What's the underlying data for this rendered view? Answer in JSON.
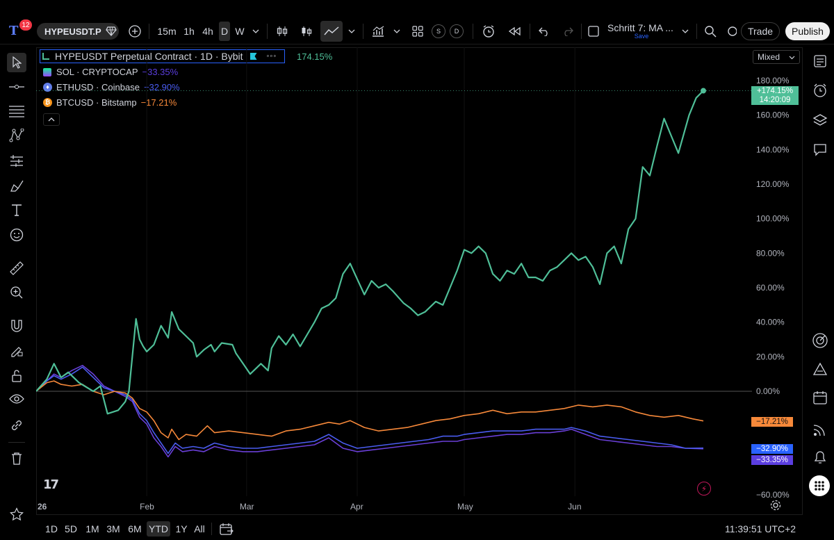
{
  "topbar": {
    "notification_count": "12",
    "symbol": "HYPEUSDT.P",
    "intervals": [
      "15m",
      "1h",
      "4h",
      "D",
      "W"
    ],
    "active_interval": "D",
    "indicator_s": "S",
    "indicator_d": "D",
    "layout_name": "Schritt 7: MA ...",
    "save_label": "Save",
    "trade_label": "Trade",
    "publish_label": "Publish"
  },
  "legend": {
    "main_title": "HYPEUSDT Perpetual Contract · 1D · Bybit",
    "main_change": "174.15%",
    "items": [
      {
        "name": "SOL · CRYPTOCAP",
        "change": "−33.35%",
        "color": "#5b3ee0"
      },
      {
        "name": "ETHUSD · Coinbase",
        "change": "−32.90%",
        "color": "#4a5cf0"
      },
      {
        "name": "BTCUSD · Bitstamp",
        "change": "−17.21%",
        "color": "#f7893a"
      }
    ]
  },
  "scale_mode": "Mixed",
  "price_labels": {
    "hype_value": "+174.15%",
    "hype_countdown": "14:20:09",
    "btc": "−17.21%",
    "eth": "−32.90%",
    "sol": "−33.35%"
  },
  "colors": {
    "hype": "#4fbf98",
    "btc": "#f7893a",
    "eth": "#4a5cf0",
    "sol": "#6a3fd8"
  },
  "chart_data": {
    "type": "line",
    "ylabel": "% change",
    "ylim": [
      -60,
      180
    ],
    "yticks": [
      180,
      160,
      140,
      120,
      100,
      80,
      60,
      40,
      20,
      0,
      -20,
      -40,
      -60
    ],
    "ytick_labels": [
      "180.00%",
      "160.00%",
      "140.00%",
      "120.00%",
      "100.00%",
      "80.00%",
      "60.00%",
      "40.00%",
      "20.00%",
      "0.00%",
      "",
      "",
      "−60.00%"
    ],
    "xticks": [
      {
        "label": "26",
        "day": 0
      },
      {
        "label": "Feb",
        "day": 31
      },
      {
        "label": "Mar",
        "day": 59
      },
      {
        "label": "Apr",
        "day": 90
      },
      {
        "label": "May",
        "day": 120
      },
      {
        "label": "Jun",
        "day": 151
      }
    ],
    "series": [
      {
        "name": "HYPEUSDT Perpetual Contract",
        "points": [
          [
            0,
            0
          ],
          [
            3,
            7
          ],
          [
            5,
            16
          ],
          [
            7,
            8
          ],
          [
            9,
            11
          ],
          [
            12,
            5
          ],
          [
            16,
            0
          ],
          [
            18,
            3
          ],
          [
            20,
            -13
          ],
          [
            23,
            -11
          ],
          [
            25,
            -6
          ],
          [
            26,
            0
          ],
          [
            27,
            21
          ],
          [
            28,
            42
          ],
          [
            29,
            30
          ],
          [
            30,
            26
          ],
          [
            31,
            23
          ],
          [
            33,
            27
          ],
          [
            35,
            38
          ],
          [
            37,
            31
          ],
          [
            38,
            46
          ],
          [
            40,
            36
          ],
          [
            42,
            32
          ],
          [
            44,
            28
          ],
          [
            45,
            20
          ],
          [
            47,
            24
          ],
          [
            49,
            27
          ],
          [
            50,
            23
          ],
          [
            52,
            28
          ],
          [
            55,
            27
          ],
          [
            56,
            22
          ],
          [
            58,
            16
          ],
          [
            60,
            10
          ],
          [
            63,
            16
          ],
          [
            65,
            12
          ],
          [
            66,
            25
          ],
          [
            68,
            32
          ],
          [
            70,
            27
          ],
          [
            72,
            33
          ],
          [
            74,
            26
          ],
          [
            76,
            33
          ],
          [
            78,
            40
          ],
          [
            80,
            48
          ],
          [
            82,
            50
          ],
          [
            84,
            54
          ],
          [
            86,
            68
          ],
          [
            88,
            74
          ],
          [
            90,
            65
          ],
          [
            92,
            56
          ],
          [
            94,
            64
          ],
          [
            96,
            60
          ],
          [
            98,
            62
          ],
          [
            100,
            58
          ],
          [
            103,
            51
          ],
          [
            105,
            48
          ],
          [
            107,
            44
          ],
          [
            109,
            46
          ],
          [
            112,
            52
          ],
          [
            114,
            50
          ],
          [
            116,
            60
          ],
          [
            118,
            70
          ],
          [
            120,
            82
          ],
          [
            122,
            80
          ],
          [
            124,
            84
          ],
          [
            126,
            80
          ],
          [
            128,
            68
          ],
          [
            130,
            64
          ],
          [
            132,
            70
          ],
          [
            134,
            68
          ],
          [
            136,
            74
          ],
          [
            138,
            66
          ],
          [
            140,
            66
          ],
          [
            142,
            64
          ],
          [
            144,
            70
          ],
          [
            146,
            72
          ],
          [
            148,
            76
          ],
          [
            150,
            80
          ],
          [
            152,
            76
          ],
          [
            154,
            78
          ],
          [
            156,
            72
          ],
          [
            158,
            62
          ],
          [
            160,
            80
          ],
          [
            162,
            84
          ],
          [
            164,
            74
          ],
          [
            166,
            94
          ],
          [
            168,
            100
          ],
          [
            170,
            130
          ],
          [
            172,
            125
          ],
          [
            174,
            142
          ],
          [
            176,
            158
          ],
          [
            178,
            148
          ],
          [
            180,
            138
          ],
          [
            183,
            160
          ],
          [
            185,
            170
          ],
          [
            187,
            174.15
          ]
        ]
      },
      {
        "name": "BTCUSD · Bitstamp",
        "points": [
          [
            0,
            0
          ],
          [
            3,
            5
          ],
          [
            5,
            6
          ],
          [
            7,
            4
          ],
          [
            10,
            3
          ],
          [
            13,
            4
          ],
          [
            16,
            0
          ],
          [
            19,
            -2
          ],
          [
            22,
            0
          ],
          [
            25,
            -1
          ],
          [
            27,
            -4
          ],
          [
            29,
            -10
          ],
          [
            31,
            -12
          ],
          [
            33,
            -17
          ],
          [
            35,
            -24
          ],
          [
            37,
            -27
          ],
          [
            38,
            -22
          ],
          [
            40,
            -28
          ],
          [
            42,
            -25
          ],
          [
            45,
            -26
          ],
          [
            48,
            -20
          ],
          [
            50,
            -24
          ],
          [
            54,
            -23
          ],
          [
            58,
            -24
          ],
          [
            62,
            -25
          ],
          [
            66,
            -26
          ],
          [
            70,
            -23
          ],
          [
            74,
            -22
          ],
          [
            78,
            -20
          ],
          [
            82,
            -18
          ],
          [
            85,
            -19
          ],
          [
            88,
            -17
          ],
          [
            92,
            -21
          ],
          [
            96,
            -23
          ],
          [
            100,
            -22
          ],
          [
            104,
            -21
          ],
          [
            108,
            -19
          ],
          [
            112,
            -17
          ],
          [
            116,
            -16
          ],
          [
            120,
            -14
          ],
          [
            124,
            -13
          ],
          [
            128,
            -11
          ],
          [
            132,
            -13
          ],
          [
            136,
            -12
          ],
          [
            140,
            -12
          ],
          [
            144,
            -11
          ],
          [
            148,
            -10
          ],
          [
            152,
            -8
          ],
          [
            156,
            -9
          ],
          [
            160,
            -8
          ],
          [
            164,
            -9
          ],
          [
            168,
            -12
          ],
          [
            172,
            -14
          ],
          [
            176,
            -15
          ],
          [
            180,
            -14
          ],
          [
            184,
            -16
          ],
          [
            187,
            -17.21
          ]
        ]
      },
      {
        "name": "ETHUSD · Coinbase",
        "points": [
          [
            0,
            0
          ],
          [
            3,
            6
          ],
          [
            5,
            9
          ],
          [
            7,
            7
          ],
          [
            10,
            10
          ],
          [
            13,
            14
          ],
          [
            16,
            8
          ],
          [
            19,
            2
          ],
          [
            22,
            0
          ],
          [
            25,
            -2
          ],
          [
            27,
            -5
          ],
          [
            29,
            -13
          ],
          [
            31,
            -17
          ],
          [
            33,
            -24
          ],
          [
            35,
            -30
          ],
          [
            37,
            -36
          ],
          [
            39,
            -30
          ],
          [
            41,
            -33
          ],
          [
            44,
            -32
          ],
          [
            47,
            -33
          ],
          [
            50,
            -30
          ],
          [
            54,
            -32
          ],
          [
            58,
            -33
          ],
          [
            62,
            -33
          ],
          [
            66,
            -32
          ],
          [
            70,
            -31
          ],
          [
            74,
            -30
          ],
          [
            78,
            -29
          ],
          [
            82,
            -25
          ],
          [
            86,
            -30
          ],
          [
            90,
            -33
          ],
          [
            94,
            -32
          ],
          [
            98,
            -31
          ],
          [
            102,
            -30
          ],
          [
            106,
            -29
          ],
          [
            110,
            -28
          ],
          [
            114,
            -26
          ],
          [
            118,
            -26
          ],
          [
            120,
            -25
          ],
          [
            124,
            -24
          ],
          [
            128,
            -23
          ],
          [
            132,
            -23
          ],
          [
            136,
            -23
          ],
          [
            140,
            -22
          ],
          [
            144,
            -22
          ],
          [
            148,
            -22
          ],
          [
            150,
            -21
          ],
          [
            154,
            -23
          ],
          [
            158,
            -26
          ],
          [
            162,
            -27
          ],
          [
            166,
            -28
          ],
          [
            170,
            -29
          ],
          [
            174,
            -30
          ],
          [
            178,
            -31
          ],
          [
            182,
            -33
          ],
          [
            187,
            -32.9
          ]
        ]
      },
      {
        "name": "SOL · CRYPTOCAP",
        "points": [
          [
            0,
            0
          ],
          [
            3,
            6
          ],
          [
            5,
            10
          ],
          [
            7,
            8
          ],
          [
            10,
            12
          ],
          [
            13,
            15
          ],
          [
            16,
            10
          ],
          [
            19,
            3
          ],
          [
            22,
            0
          ],
          [
            25,
            -3
          ],
          [
            27,
            -6
          ],
          [
            29,
            -15
          ],
          [
            31,
            -19
          ],
          [
            33,
            -27
          ],
          [
            35,
            -32
          ],
          [
            37,
            -38
          ],
          [
            39,
            -32
          ],
          [
            41,
            -35
          ],
          [
            44,
            -34
          ],
          [
            47,
            -35
          ],
          [
            50,
            -32
          ],
          [
            54,
            -34
          ],
          [
            58,
            -35
          ],
          [
            62,
            -35
          ],
          [
            66,
            -34
          ],
          [
            70,
            -33
          ],
          [
            74,
            -32
          ],
          [
            78,
            -31
          ],
          [
            82,
            -27
          ],
          [
            86,
            -33
          ],
          [
            90,
            -35
          ],
          [
            94,
            -34
          ],
          [
            98,
            -33
          ],
          [
            102,
            -32
          ],
          [
            106,
            -31
          ],
          [
            110,
            -30
          ],
          [
            114,
            -29
          ],
          [
            118,
            -29
          ],
          [
            120,
            -28
          ],
          [
            124,
            -27
          ],
          [
            128,
            -26
          ],
          [
            132,
            -25
          ],
          [
            136,
            -25
          ],
          [
            140,
            -24
          ],
          [
            144,
            -24
          ],
          [
            148,
            -23
          ],
          [
            150,
            -22
          ],
          [
            154,
            -25
          ],
          [
            158,
            -28
          ],
          [
            162,
            -29
          ],
          [
            166,
            -30
          ],
          [
            170,
            -31
          ],
          [
            174,
            -32
          ],
          [
            178,
            -32
          ],
          [
            182,
            -33
          ],
          [
            187,
            -33.35
          ]
        ]
      }
    ]
  },
  "bottom": {
    "ranges": [
      "1D",
      "5D",
      "1M",
      "3M",
      "6M",
      "YTD",
      "1Y",
      "All"
    ],
    "active_range": "YTD",
    "clock": "11:39:51 UTC+2"
  },
  "icons": {
    "left": [
      "cursor-icon",
      "horizontal-line-icon",
      "fib-lines-icon",
      "pattern-icon",
      "long-short-icon",
      "brush-icon",
      "text-tool-icon",
      "emoji-icon",
      "ruler-icon",
      "zoom-in-icon",
      "magnet-icon",
      "lock-draw-icon",
      "lock-icon",
      "eye-icon",
      "link-icon",
      "trash-icon",
      "star-icon"
    ],
    "right": [
      "watchlist-icon",
      "alarm-clock-icon",
      "layers-icon",
      "chat-icon",
      "target-icon",
      "triangle-chart-icon",
      "calendar-icon",
      "broadcast-icon",
      "bell-icon",
      "more-dots-icon"
    ]
  }
}
